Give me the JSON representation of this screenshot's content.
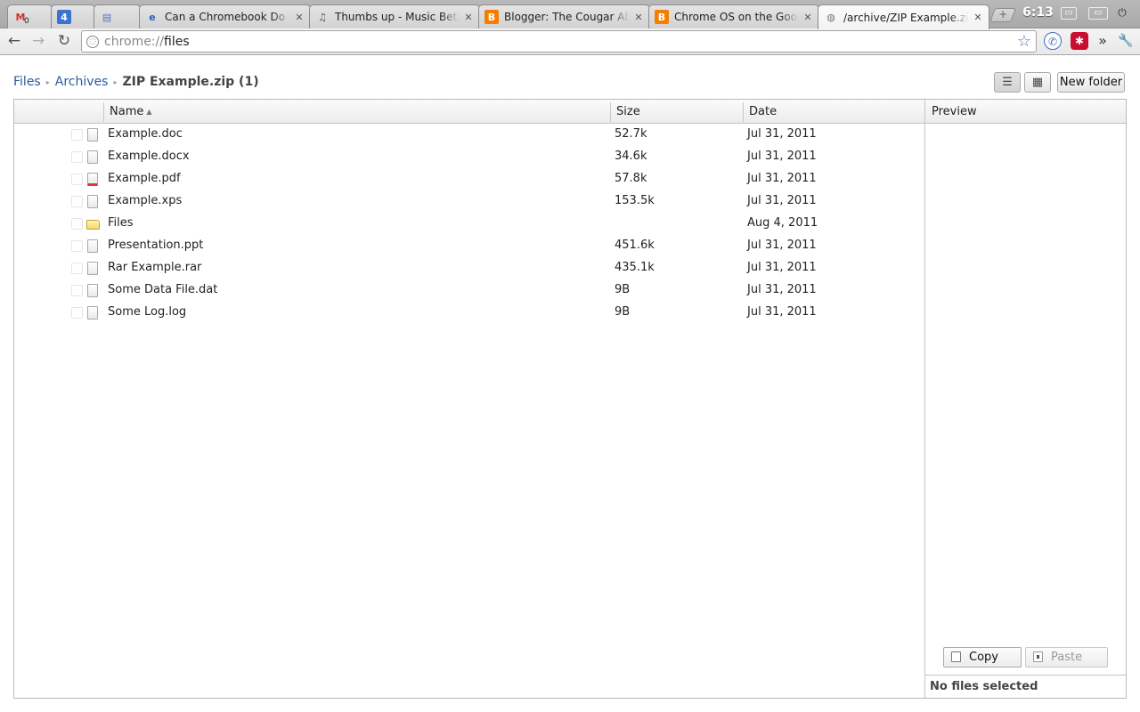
{
  "tabs": [
    {
      "title": "",
      "favicon": "gmail-icon",
      "favicon_text": "M",
      "badge": "0",
      "color": "#d93025"
    },
    {
      "title": "",
      "favicon": "calendar-icon",
      "favicon_text": "4",
      "color": "#3b73d1"
    },
    {
      "title": "",
      "favicon": "docs-icon",
      "favicon_text": "▤",
      "color": "#4a74c9"
    },
    {
      "title": "Can a Chromebook Do R",
      "favicon": "ie-e-icon",
      "favicon_text": "e",
      "color": "#2a63b8"
    },
    {
      "title": "Thumbs up - Music Beta",
      "favicon": "headphones-icon",
      "favicon_text": "♫",
      "color": "#555555"
    },
    {
      "title": "Blogger: The Cougar Ab",
      "favicon": "blogger-icon",
      "favicon_text": "B",
      "color": "#f57d00"
    },
    {
      "title": "Chrome OS on the Goog",
      "favicon": "blogger-icon",
      "favicon_text": "B",
      "color": "#f57d00"
    },
    {
      "title": "/archive/ZIP Example.zip",
      "favicon": "globe-icon",
      "favicon_text": "◍",
      "color": "#777777"
    }
  ],
  "tab_close_glyph": "✕",
  "newtab_glyph": "+",
  "clock": "6:13",
  "nav": {
    "back": "←",
    "forward": "→",
    "reload": "↻"
  },
  "omnibox": {
    "scheme": "chrome://",
    "host": "files",
    "star": "☆"
  },
  "extensions": {
    "overflow": "»",
    "wrench": "🔧"
  },
  "breadcrumb": [
    {
      "label": "Files"
    },
    {
      "label": "Archives"
    },
    {
      "label": "ZIP Example.zip (1)"
    }
  ],
  "breadcrumb_sep": "▸",
  "view": {
    "list_glyph": "☰",
    "grid_glyph": "▦",
    "new_folder": "New folder"
  },
  "columns": {
    "name": "Name",
    "size": "Size",
    "date": "Date",
    "sort_arrow": "▲"
  },
  "files": [
    {
      "name": "Example.doc",
      "size": "52.7k",
      "date": "Jul 31, 2011",
      "icon": "document-icon"
    },
    {
      "name": "Example.docx",
      "size": "34.6k",
      "date": "Jul 31, 2011",
      "icon": "document-icon"
    },
    {
      "name": "Example.pdf",
      "size": "57.8k",
      "date": "Jul 31, 2011",
      "icon": "pdf-icon"
    },
    {
      "name": "Example.xps",
      "size": "153.5k",
      "date": "Jul 31, 2011",
      "icon": "document-icon"
    },
    {
      "name": "Files",
      "size": "",
      "date": "Aug 4, 2011",
      "icon": "folder-icon"
    },
    {
      "name": "Presentation.ppt",
      "size": "451.6k",
      "date": "Jul 31, 2011",
      "icon": "document-icon"
    },
    {
      "name": "Rar Example.rar",
      "size": "435.1k",
      "date": "Jul 31, 2011",
      "icon": "document-icon"
    },
    {
      "name": "Some Data File.dat",
      "size": "9B",
      "date": "Jul 31, 2011",
      "icon": "document-icon"
    },
    {
      "name": "Some Log.log",
      "size": "9B",
      "date": "Jul 31, 2011",
      "icon": "document-icon"
    }
  ],
  "preview": {
    "title": "Preview",
    "copy": "Copy",
    "paste": "Paste",
    "status": "No files selected"
  }
}
